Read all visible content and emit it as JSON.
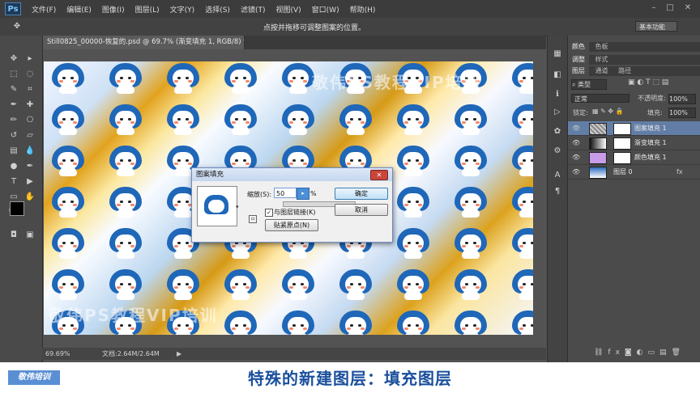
{
  "app": {
    "logo": "Ps"
  },
  "menu": [
    "文件(F)",
    "编辑(E)",
    "图像(I)",
    "图层(L)",
    "文字(Y)",
    "选择(S)",
    "滤镜(T)",
    "视图(V)",
    "窗口(W)",
    "帮助(H)"
  ],
  "options": {
    "hint": "点按并拖移可调整图案的位置。",
    "workspace": "基本功能"
  },
  "document": {
    "tab_title": "Still0825_00000-恢复的.psd @ 69.7% (渐变填充 1, RGB/8) *"
  },
  "status": {
    "zoom": "69.69%",
    "doc_size": "文档:2.64M/2.64M"
  },
  "watermark": "敬伟PS教程VIP培训",
  "panels": {
    "tabs_row1": [
      "色板",
      "色板"
    ],
    "tabs_row1_labels": [
      "颜色",
      "色板"
    ],
    "tabs_row2": [
      "调整",
      "样式"
    ],
    "tabs_row3": [
      "图层",
      "通道",
      "路径"
    ],
    "filter_kind": "类型",
    "blend_mode": "正常",
    "opacity_label": "不透明度:",
    "opacity_value": "100%",
    "lock_label": "锁定:",
    "fill_label": "填充:",
    "fill_value": "100%"
  },
  "layers": [
    {
      "name": "图案填充 1",
      "selected": true,
      "thumb": "pattern"
    },
    {
      "name": "渐变填充 1",
      "selected": false,
      "thumb": "gradient"
    },
    {
      "name": "颜色填充 1",
      "selected": false,
      "thumb": "color"
    },
    {
      "name": "图层 0",
      "selected": false,
      "thumb": "image"
    }
  ],
  "dialog": {
    "title": "图案填充",
    "scale_label": "缩放(S):",
    "scale_value": "50",
    "scale_unit": "%",
    "ok": "确定",
    "cancel": "取消",
    "link_label": "与图层链接(K)",
    "snap_button": "贴紧原点(N)"
  },
  "caption": "特殊的新建图层：填充图层",
  "brand": "敬伟培训",
  "colors": {
    "accent": "#1a4f9c",
    "selection": "#627ea6"
  }
}
